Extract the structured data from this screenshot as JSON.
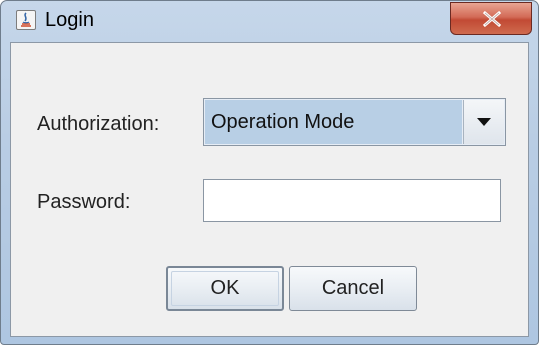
{
  "window": {
    "title": "Login",
    "icon": "java-app-icon",
    "close_icon": "close-icon"
  },
  "form": {
    "authorization_label": "Authorization:",
    "authorization_value": "Operation Mode",
    "password_label": "Password:",
    "password_value": ""
  },
  "buttons": {
    "ok_label": "OK",
    "cancel_label": "Cancel"
  },
  "colors": {
    "title_gradient": "#b9cde4",
    "close_red": "#c24a34",
    "combo_selected": "#b8cfe5",
    "panel": "#f0f0f0"
  }
}
